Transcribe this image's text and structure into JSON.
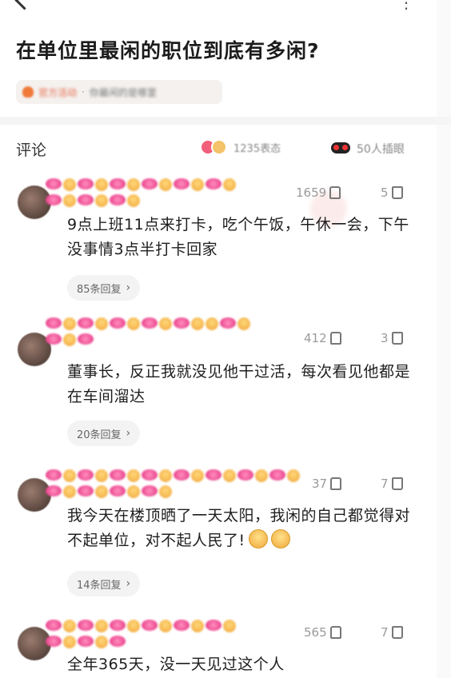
{
  "question": {
    "title": "在单位里最闲的职位到底有多闲?",
    "tag_official": "官方活动",
    "tag_topic": "你最闲的是哪里"
  },
  "comments_header": {
    "label": "评论",
    "reaction_count": "1235表态",
    "eyes_count": "50人插眼"
  },
  "comments": [
    {
      "likes": "1659",
      "dislikes": "5",
      "text": "9点上班11点来打卡，吃个午饭，午休一会，下午没事情3点半打卡回家",
      "replies": "85条回复"
    },
    {
      "likes": "412",
      "dislikes": "3",
      "text": "董事长，反正我就没见他干过活，每次看见他都是在车间溜达",
      "replies": "20条回复"
    },
    {
      "likes": "37",
      "dislikes": "7",
      "text": "我今天在楼顶晒了一天太阳，我闲的自己都觉得对不起单位，对不起人民了!",
      "replies": "14条回复"
    },
    {
      "likes": "565",
      "dislikes": "7",
      "text": "全年365天，没一天见过这个人",
      "replies": ""
    }
  ],
  "icons": [
    "back-icon",
    "more-icon",
    "flame-icon",
    "heart-icon",
    "smile-icon",
    "eyes-icon",
    "thumb-up-icon",
    "thumb-down-icon",
    "chevron-right-icon",
    "emoji-icon"
  ],
  "colors": {
    "accent": "#e86a4a",
    "text": "#1e1e1e",
    "muted": "#9a9a9a"
  }
}
